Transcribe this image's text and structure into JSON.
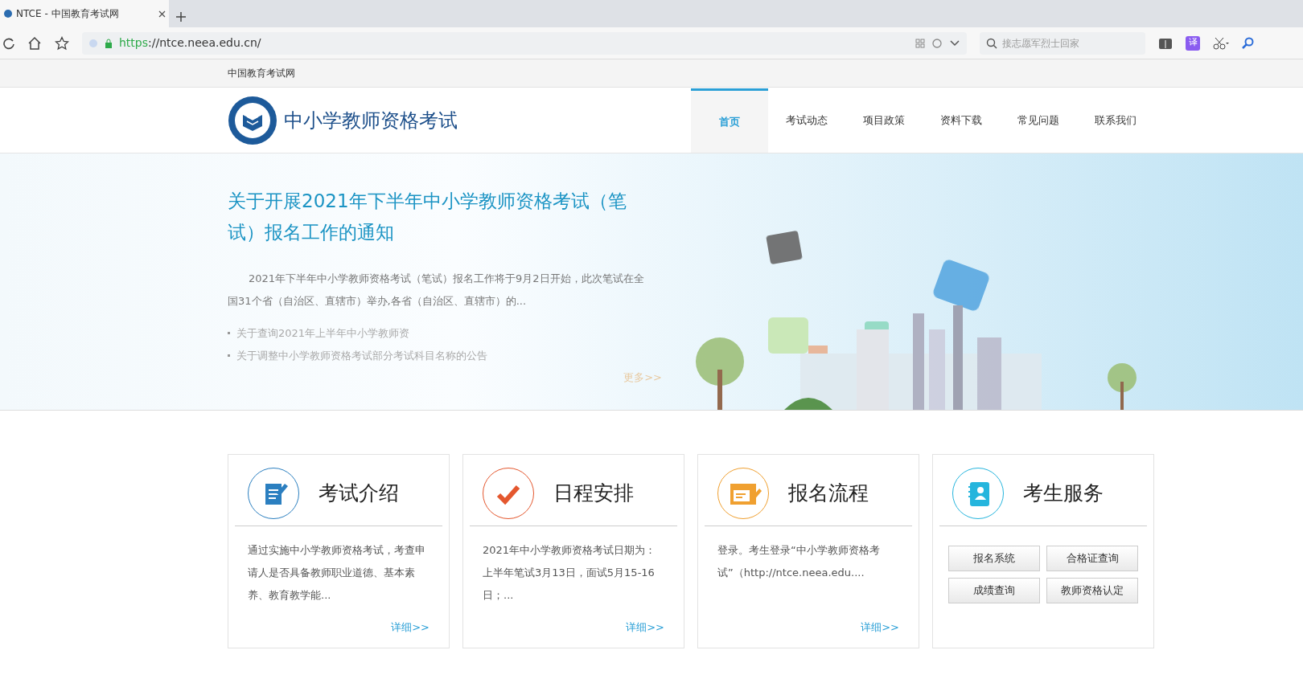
{
  "browser": {
    "tabs": [
      {
        "title": "NTCE - 中国教育考试网",
        "selected": true
      }
    ],
    "url_scheme": "https",
    "url_rest": "://ntce.neea.edu.cn/",
    "search_placeholder": "接志愿军烈士回家",
    "translate_label": "译"
  },
  "site": {
    "top_label": "中国教育考试网",
    "logo_title": "中小学教师资格考试",
    "nav": [
      {
        "label": "首页",
        "selected": true
      },
      {
        "label": "考试动态",
        "selected": false
      },
      {
        "label": "项目政策",
        "selected": false
      },
      {
        "label": "资料下载",
        "selected": false
      },
      {
        "label": "常见问题",
        "selected": false
      },
      {
        "label": "联系我们",
        "selected": false
      }
    ],
    "hero": {
      "title": "关于开展2021年下半年中小学教师资格考试（笔试）报名工作的通知",
      "summary": "2021年下半年中小学教师资格考试（笔试）报名工作将于9月2日开始，此次笔试在全国31个省（自治区、直辖市）举办,各省（自治区、直辖市）的...",
      "news": [
        "关于查询2021年上半年中小学教师资",
        "关于调整中小学教师资格考试部分考试科目名称的公告"
      ],
      "more": "更多>>"
    },
    "cards": [
      {
        "kind": "text",
        "title": "考试介绍",
        "color": "#2b7fc0",
        "body": "通过实施中小学教师资格考试，考查申请人是否具备教师职业道德、基本素养、教育教学能...",
        "more": "详细>>"
      },
      {
        "kind": "text",
        "title": "日程安排",
        "color": "#e4572e",
        "body": "2021年中小学教师资格考试日期为：上半年笔试3月13日，面试5月15-16日；...",
        "more": "详细>>"
      },
      {
        "kind": "text",
        "title": "报名流程",
        "color": "#f0a030",
        "body": "登录。考生登录“中小学教师资格考试”（http://ntce.neea.edu....",
        "more": "详细>>"
      },
      {
        "kind": "buttons",
        "title": "考生服务",
        "color": "#25b5dd",
        "buttons": [
          "报名系统",
          "合格证查询",
          "成绩查询",
          "教师资格认定"
        ]
      }
    ]
  }
}
